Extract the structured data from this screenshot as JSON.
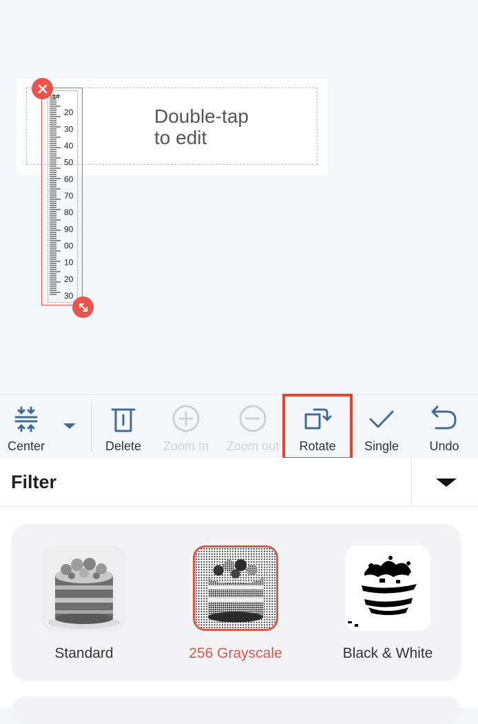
{
  "canvas": {
    "text_box": {
      "text": "Double-tap\nto edit"
    },
    "ruler": {
      "labels": [
        "14",
        "20",
        "30",
        "40",
        "50",
        "60",
        "70",
        "80",
        "90",
        "00",
        "10",
        "20",
        "30"
      ]
    },
    "handles": {
      "delete": "close-icon",
      "resize": "resize-diagonal-icon"
    }
  },
  "toolbar": {
    "items": [
      {
        "key": "center",
        "label": "Center",
        "icon": "align-center-icon",
        "enabled": true
      },
      {
        "key": "delete",
        "label": "Delete",
        "icon": "trash-icon",
        "enabled": true
      },
      {
        "key": "zoom_in",
        "label": "Zoom In",
        "icon": "zoom-in-icon",
        "enabled": false
      },
      {
        "key": "zoom_out",
        "label": "Zoom out",
        "icon": "zoom-out-icon",
        "enabled": false
      },
      {
        "key": "rotate",
        "label": "Rotate",
        "icon": "rotate-icon",
        "enabled": true,
        "highlighted": true
      },
      {
        "key": "single",
        "label": "Single",
        "icon": "check-icon",
        "enabled": true
      },
      {
        "key": "undo",
        "label": "Undo",
        "icon": "undo-icon",
        "enabled": true
      }
    ]
  },
  "filter": {
    "title": "Filter",
    "options": [
      {
        "label": "Standard",
        "selected": false
      },
      {
        "label": "256 Grayscale",
        "selected": true
      },
      {
        "label": "Black & White",
        "selected": false
      }
    ]
  },
  "colors": {
    "accent": "#e8554c",
    "highlight": "#e8432b",
    "selected_text": "#d2594d",
    "disabled_text": "#d2d3d8",
    "canvas_bg": "#f5f6fa"
  }
}
